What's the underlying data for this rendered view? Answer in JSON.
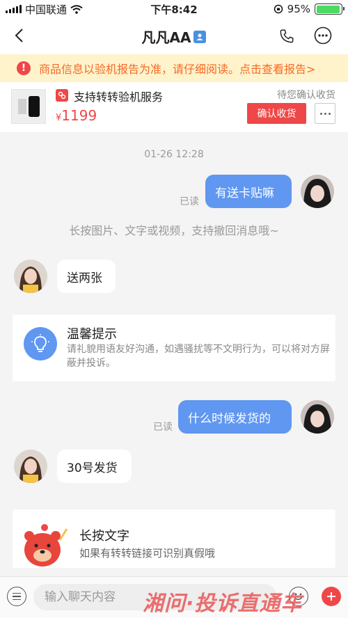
{
  "status_bar": {
    "carrier": "中国联通",
    "time": "下午8:42",
    "battery_percent": "95%",
    "battery_level": 0.95
  },
  "header": {
    "title": "凡凡AA",
    "back_icon": "chevron-left-icon",
    "phone_icon": "phone-icon",
    "more_icon": "more-circle-icon"
  },
  "notice": {
    "text": "商品信息以验机报告为准，请仔细阅读。点击查看报告>",
    "color": "#f56a25",
    "background": "#fff3cc"
  },
  "product": {
    "title": "支持转转验机服务",
    "price_symbol": "¥",
    "price": "1199",
    "status": "待您确认收货",
    "confirm_label": "确认收货"
  },
  "chat": {
    "timestamp": "01-26 12:28",
    "read_label": "已读",
    "system_hint": "长按图片、文字或视频，支持撤回消息哦~",
    "messages": [
      {
        "direction": "out",
        "text": "有送卡贴嘛",
        "read": "已读"
      },
      {
        "direction": "in",
        "text": "送两张"
      },
      {
        "direction": "out",
        "text": "什么时候发货的",
        "read": "已读"
      },
      {
        "direction": "in",
        "text": "30号发货"
      }
    ],
    "tip": {
      "title": "温馨提示",
      "body": "请礼貌用语友好沟通，如遇骚扰等不文明行为，可以将对方屏蔽并投诉。",
      "icon": "lightbulb-icon"
    },
    "promo": {
      "title": "长按文字",
      "subtitle": "如果有转转链接可识别真假哦",
      "icon": "bear-mascot"
    }
  },
  "input_bar": {
    "placeholder": "输入聊天内容",
    "value": "",
    "menu_icon": "menu-icon",
    "emoji_icon": "emoji-icon",
    "plus_icon": "plus-icon"
  },
  "watermark": "湘问·投诉直通车",
  "colors": {
    "accent_red": "#ef4747",
    "bubble_blue": "#5f97f1",
    "background": "#f4f4f4"
  }
}
